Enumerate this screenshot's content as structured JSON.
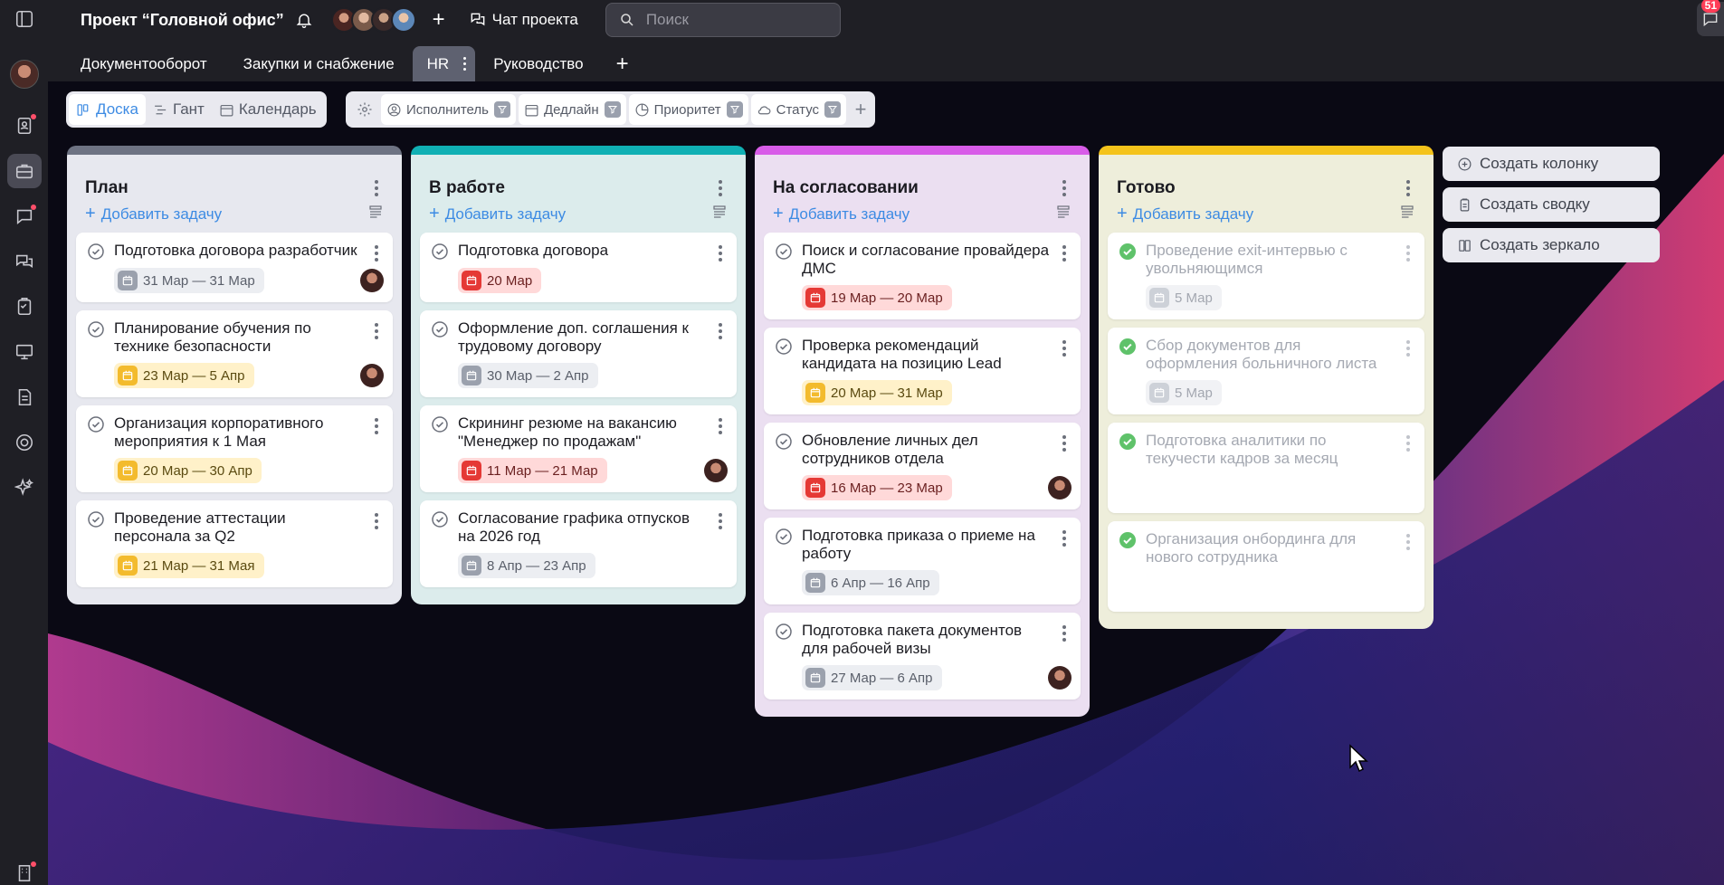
{
  "colors": {
    "accent": "#3d8be3",
    "plan_stripe": "#6e7383",
    "plan_bg": "#e7e8ef",
    "inwork_stripe": "#10b0b4",
    "inwork_bg": "#dcecec",
    "approval_stripe": "#d85ce8",
    "approval_bg": "#ebdff1",
    "done_stripe": "#f4c31b",
    "done_bg": "#eeeedb"
  },
  "topbar": {
    "project_title": "Проект “Головной офис”",
    "chat_label": "Чат проекта",
    "search_placeholder": "Поиск",
    "message_badge": "51"
  },
  "tabs": [
    {
      "label": "Документооборот"
    },
    {
      "label": "Закупки и снабжение"
    },
    {
      "label": "HR",
      "active": true
    },
    {
      "label": "Руководство"
    }
  ],
  "views": [
    {
      "label": "Доска",
      "icon": "board-icon",
      "active": true
    },
    {
      "label": "Гант",
      "icon": "gantt-icon"
    },
    {
      "label": "Календарь",
      "icon": "calendar-icon"
    }
  ],
  "filters": [
    {
      "label": "Исполнитель",
      "icon": "user-icon"
    },
    {
      "label": "Дедлайн",
      "icon": "calendar-icon"
    },
    {
      "label": "Приоритет",
      "icon": "priority-icon"
    },
    {
      "label": "Статус",
      "icon": "cloud-icon"
    }
  ],
  "add_task_label": "Добавить задачу",
  "columns": [
    {
      "title": "План",
      "cards": [
        {
          "title": "Подготовка договора разработчик",
          "date": "31 Мар — 31 Мар",
          "date_style": "gray",
          "avatar": true
        },
        {
          "title": "Планирование обучения по технике безопасности",
          "date": "23 Мар — 5 Апр",
          "date_style": "yellow",
          "avatar": true
        },
        {
          "title": "Организация корпоративного мероприятия к 1 Мая",
          "date": "20 Мар — 30 Апр",
          "date_style": "yellow",
          "avatar": false
        },
        {
          "title": "Проведение аттестации персонала за Q2",
          "date": "21 Мар — 31 Мая",
          "date_style": "yellow",
          "avatar": false
        }
      ]
    },
    {
      "title": "В работе",
      "cards": [
        {
          "title": "Подготовка договора",
          "date": "20 Мар",
          "date_style": "red",
          "avatar": false
        },
        {
          "title": "Оформление доп. соглашения к трудовому договору",
          "date": "30 Мар — 2 Апр",
          "date_style": "gray",
          "avatar": false
        },
        {
          "title": "Скрининг резюме на вакансию \"Менеджер по продажам\"",
          "date": "11 Мар — 21 Мар",
          "date_style": "red",
          "avatar": true
        },
        {
          "title": "Согласование графика отпусков на 2026 год",
          "date": "8 Апр — 23 Апр",
          "date_style": "gray",
          "avatar": false
        }
      ]
    },
    {
      "title": "На согласовании",
      "cards": [
        {
          "title": "Поиск и согласование провайдера ДМС",
          "date": "19 Мар — 20 Мар",
          "date_style": "red",
          "avatar": false
        },
        {
          "title": "Проверка рекомендаций кандидата на позицию Lead",
          "date": "20 Мар — 31 Мар",
          "date_style": "yellow",
          "avatar": false
        },
        {
          "title": "Обновление личных дел сотрудников отдела",
          "date": "16 Мар — 23 Мар",
          "date_style": "red",
          "avatar": true
        },
        {
          "title": "Подготовка приказа о приеме на работу",
          "date": "6 Апр — 16 Апр",
          "date_style": "gray",
          "avatar": false
        },
        {
          "title": "Подготовка пакета документов для рабочей визы",
          "date": "27 Мар — 6 Апр",
          "date_style": "gray",
          "avatar": true
        }
      ]
    },
    {
      "title": "Готово",
      "done": true,
      "cards": [
        {
          "title": "Проведение exit-интервью с увольняющимся",
          "date": "5 Мар",
          "date_style": "faded",
          "avatar": false
        },
        {
          "title": "Сбор документов для оформления больничного листа",
          "date": "5 Мар",
          "date_style": "faded",
          "avatar": false
        },
        {
          "title": "Подготовка аналитики по текучести кадров за месяц",
          "date": "",
          "date_style": "none",
          "avatar": false
        },
        {
          "title": "Организация онбординга для нового сотрудника",
          "date": "",
          "date_style": "none",
          "avatar": false
        }
      ]
    }
  ],
  "side_buttons": [
    {
      "label": "Создать колонку",
      "icon": "plus-circle-icon"
    },
    {
      "label": "Создать сводку",
      "icon": "clipboard-icon"
    },
    {
      "label": "Создать зеркало",
      "icon": "mirror-icon"
    }
  ]
}
